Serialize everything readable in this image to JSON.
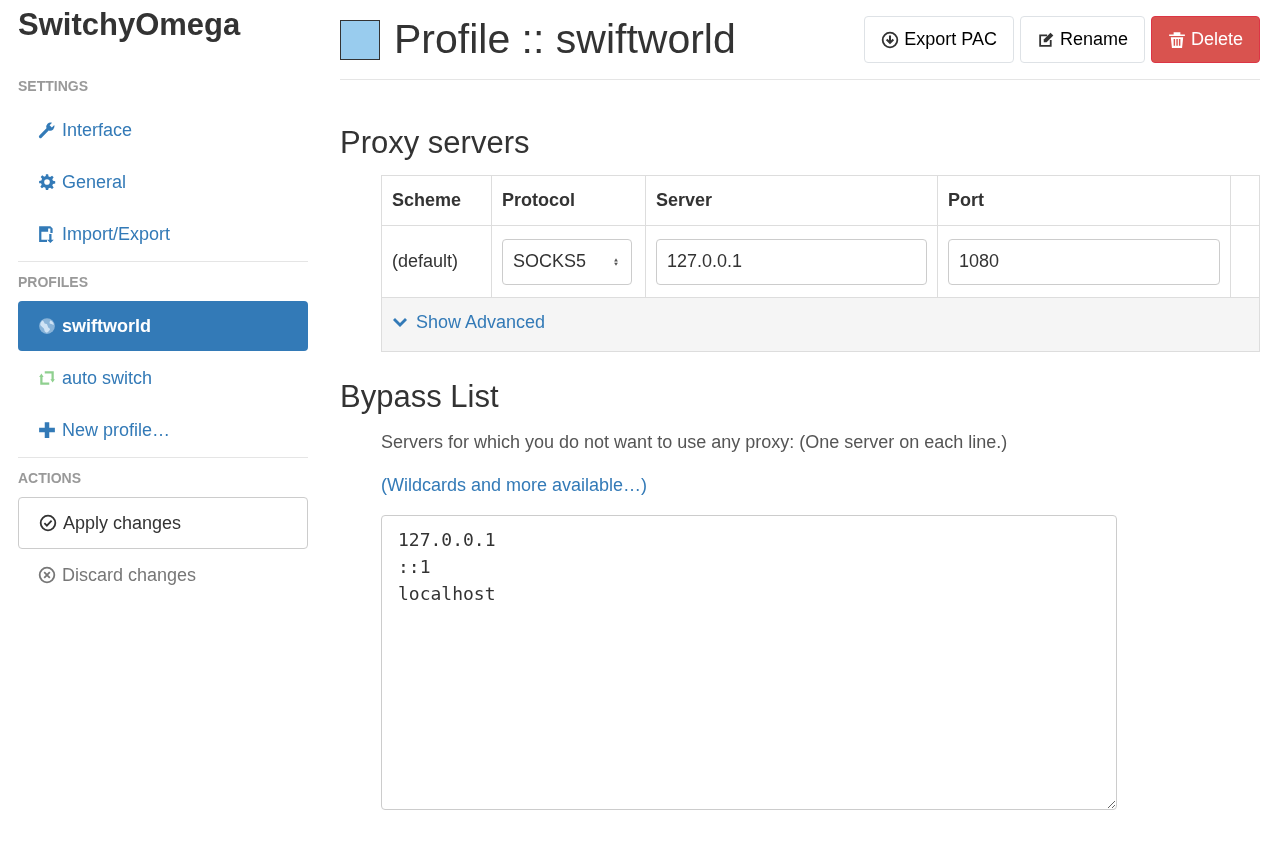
{
  "app_title": "SwitchyOmega",
  "sidebar": [
    {
      "heading": "SETTINGS",
      "items": [
        {
          "label": "Interface",
          "selected": false
        },
        {
          "label": "General",
          "selected": false
        },
        {
          "label": "Import/Export",
          "selected": false
        }
      ]
    },
    {
      "heading": "PROFILES",
      "items": [
        {
          "label": "swiftworld",
          "selected": true
        },
        {
          "label": "auto switch",
          "selected": false
        },
        {
          "label": "New profile…",
          "selected": false
        }
      ]
    },
    {
      "heading": "ACTIONS",
      "items": [
        {
          "label": "Apply changes",
          "kind": "button"
        },
        {
          "label": "Discard changes",
          "kind": "link"
        }
      ]
    }
  ],
  "profile": {
    "title": "Profile :: swiftworld",
    "color": "#99ccee"
  },
  "header_buttons": [
    {
      "label": "Export PAC",
      "kind": "default"
    },
    {
      "label": "Rename",
      "kind": "default"
    },
    {
      "label": "Delete",
      "kind": "danger"
    }
  ],
  "proxy_servers": {
    "heading": "Proxy servers",
    "columns": [
      "Scheme",
      "Protocol",
      "Server",
      "Port"
    ],
    "rows": [
      {
        "scheme": "(default)",
        "protocol": "SOCKS5",
        "server": "127.0.0.1",
        "port": "1080"
      }
    ],
    "advanced_link": "Show Advanced"
  },
  "bypass": {
    "heading": "Bypass List",
    "description": "Servers for which you do not want to use any proxy: (One server on each line.)",
    "link": "(Wildcards and more available…)",
    "value": "127.0.0.1\n::1\nlocalhost"
  }
}
